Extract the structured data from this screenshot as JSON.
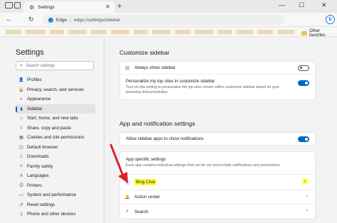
{
  "browser": {
    "tab_title": "Settings",
    "tab_close": "✕",
    "new_tab": "+",
    "win_min": "—",
    "win_max": "☐",
    "win_close": "✕",
    "nav_back": "←",
    "nav_refresh": "↻",
    "address_host": "Edge",
    "address_sep": "|",
    "address_url": "edge://settings/sidebar",
    "bing_icon": "b",
    "other_favorites": "Other favorites"
  },
  "settings_nav": {
    "title": "Settings",
    "search_placeholder": "Search settings",
    "items": [
      {
        "label": "Profiles",
        "icon": "person-icon",
        "glyph": "👤",
        "active": false
      },
      {
        "label": "Privacy, search, and services",
        "icon": "lock-icon",
        "glyph": "🔒",
        "active": false
      },
      {
        "label": "Appearance",
        "icon": "palette-icon",
        "glyph": "◐",
        "active": false
      },
      {
        "label": "Sidebar",
        "icon": "sidebar-icon",
        "glyph": "▮",
        "active": true
      },
      {
        "label": "Start, home, and new tabs",
        "icon": "home-icon",
        "glyph": "⌂",
        "active": false
      },
      {
        "label": "Share, copy and paste",
        "icon": "share-icon",
        "glyph": "⇪",
        "active": false
      },
      {
        "label": "Cookies and site permissions",
        "icon": "cookie-icon",
        "glyph": "▦",
        "active": false
      },
      {
        "label": "Default browser",
        "icon": "browser-icon",
        "glyph": "◫",
        "active": false
      },
      {
        "label": "Downloads",
        "icon": "download-icon",
        "glyph": "⤓",
        "active": false
      },
      {
        "label": "Family safety",
        "icon": "family-icon",
        "glyph": "☺",
        "active": false
      },
      {
        "label": "Languages",
        "icon": "language-icon",
        "glyph": "A",
        "active": false
      },
      {
        "label": "Printers",
        "icon": "printer-icon",
        "glyph": "⎙",
        "active": false
      },
      {
        "label": "System and performance",
        "icon": "system-icon",
        "glyph": "▭",
        "active": false
      },
      {
        "label": "Reset settings",
        "icon": "reset-icon",
        "glyph": "↺",
        "active": false
      },
      {
        "label": "Phone and other devices",
        "icon": "phone-icon",
        "glyph": "▯",
        "active": false
      }
    ]
  },
  "customize": {
    "title": "Customize sidebar",
    "always_show": {
      "label": "Always show sidebar",
      "icon": "sidebar-icon",
      "glyph": "⊟",
      "enabled": false
    },
    "personalize": {
      "label": "Personalize my top sites in customize sidebar",
      "description": "Turn on this setting to personalize the top sites shown within customize sidebar based on your browsing history/activities",
      "enabled": true
    }
  },
  "app_notifications": {
    "title": "App and notification settings",
    "allow_notifications": {
      "label": "Allow sidebar apps to show notifications",
      "enabled": true
    },
    "app_specific": {
      "title": "App specific settings",
      "description": "Each app contains individual settings that can be set and include notifications and permissions"
    },
    "apps": [
      {
        "label": "Bing Chat",
        "icon": "bing-chat-icon",
        "glyph": "ⓑ",
        "highlighted": true
      },
      {
        "label": "Action center",
        "icon": "bell-icon",
        "glyph": "🔔",
        "highlighted": false
      },
      {
        "label": "Search",
        "icon": "search-icon",
        "glyph": "⌕",
        "highlighted": false
      }
    ],
    "chevron": "›"
  },
  "colors": {
    "accent": "#0067c0",
    "highlight": "#ffff3a",
    "annotation_arrow": "#e02020"
  }
}
